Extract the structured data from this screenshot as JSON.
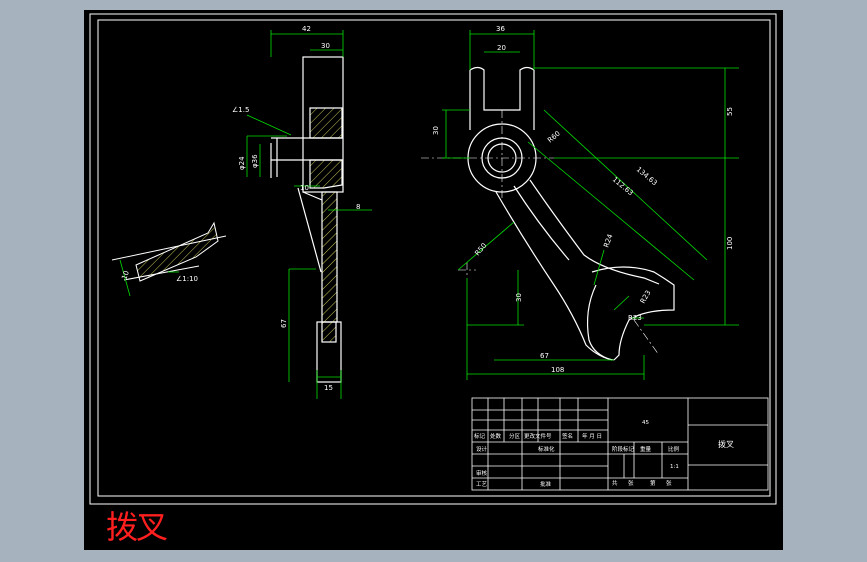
{
  "caption": "拨叉",
  "colors": {
    "background": "#a6b2be",
    "canvas": "#000000",
    "outline": "#ffffff",
    "dimension": "#00e000",
    "hatch": "#c8c85a",
    "caption": "#ff1f1f"
  },
  "side_view": {
    "top_width": "42",
    "top_inner": "30",
    "angle_top": "∠1.5",
    "dia_outer": "φ24",
    "dia_inner": "φ36",
    "web_step": "10",
    "web_thickness": "8",
    "angle_detail": "∠1:10",
    "detail_dim": "10",
    "lower_length": "67",
    "bottom_width": "15"
  },
  "main_view": {
    "top_width": "36",
    "slot_width": "20",
    "height_55": "55",
    "hub_height": "30",
    "radius_hub": "R60",
    "dim_112": "112.63",
    "dim_134": "134.63",
    "radius_r24": "R24",
    "radius_r23": "R23",
    "height_100": "100",
    "radius_r50": "R50",
    "fork_radius": "R23",
    "height_30": "30",
    "dim_67": "67",
    "total_width": "108"
  },
  "title_block": {
    "part_name": "拨叉",
    "material": "45",
    "row_labels": [
      "标记",
      "处数",
      "分区",
      "更改文件号",
      "签名",
      "年 月 日"
    ],
    "designer": "设计",
    "standardize": "标准化",
    "reviewer": "审核",
    "process": "工艺",
    "approve": "批准",
    "stage_label": "阶段标记",
    "weight_label": "重量",
    "scale_label": "比例",
    "scale_value": "1:1",
    "sheet_total": "共",
    "sheet_total_unit": "张",
    "sheet_num": "第",
    "sheet_num_unit": "张"
  }
}
